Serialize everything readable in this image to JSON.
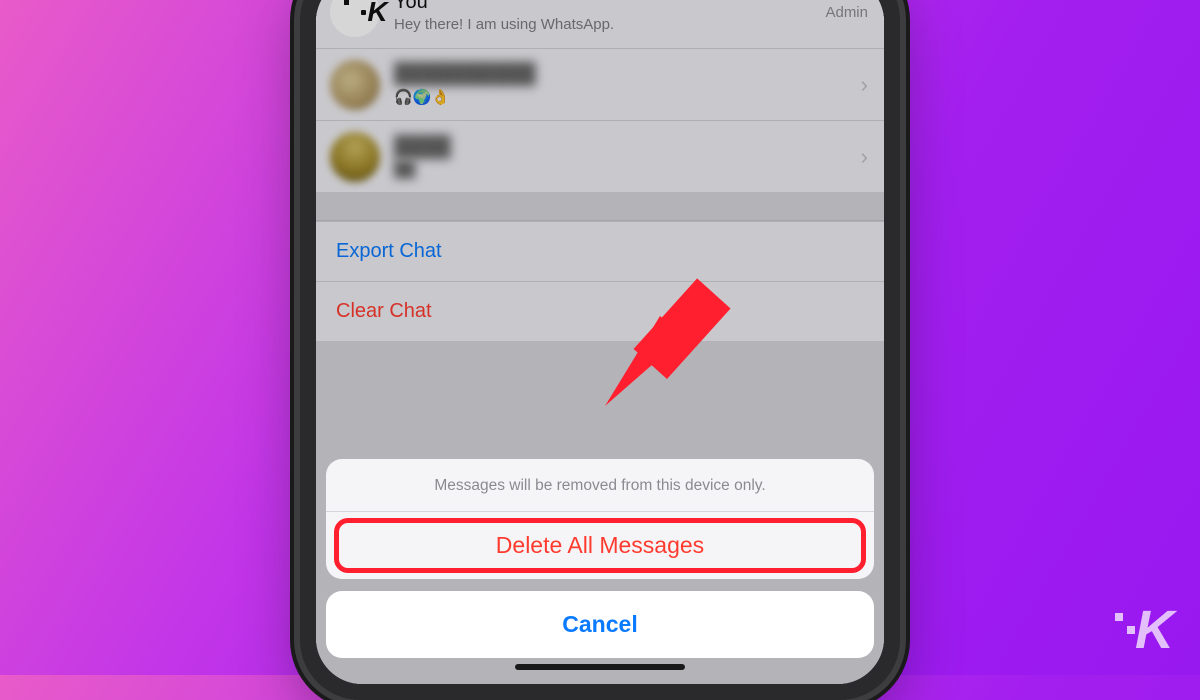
{
  "participants": [
    {
      "name": "You",
      "status": "Hey there! I am using WhatsApp.",
      "role": "Admin"
    },
    {
      "name": "██████████",
      "status": "🎧🌍👌",
      "role": ""
    },
    {
      "name": "████",
      "status": "██",
      "role": ""
    }
  ],
  "actions": {
    "export": "Export Chat",
    "clear": "Clear Chat"
  },
  "sheet": {
    "message": "Messages will be removed from this device only.",
    "delete": "Delete All Messages",
    "cancel": "Cancel"
  },
  "colors": {
    "blue": "#0a7aff",
    "red": "#ff3b30",
    "highlight": "#ff1f2e"
  }
}
